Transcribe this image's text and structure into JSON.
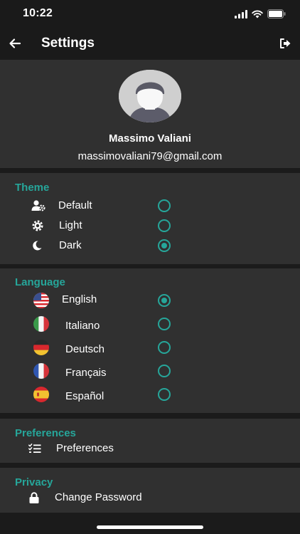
{
  "status_bar": {
    "time": "10:22"
  },
  "app_bar": {
    "title": "Settings"
  },
  "profile": {
    "name": "Massimo Valiani",
    "email": "massimovaliani79@gmail.com"
  },
  "theme": {
    "header": "Theme",
    "options": [
      {
        "label": "Default",
        "icon": "user-gear-icon",
        "selected": false
      },
      {
        "label": "Light",
        "icon": "sun-icon",
        "selected": false
      },
      {
        "label": "Dark",
        "icon": "moon-icon",
        "selected": true
      }
    ]
  },
  "language": {
    "header": "Language",
    "options": [
      {
        "label": "English",
        "icon": "us-flag-icon",
        "selected": true
      },
      {
        "label": "Italiano",
        "icon": "italy-flag-icon",
        "selected": false
      },
      {
        "label": "Deutsch",
        "icon": "germany-flag-icon",
        "selected": false
      },
      {
        "label": "Français",
        "icon": "france-flag-icon",
        "selected": false
      },
      {
        "label": "Español",
        "icon": "spain-flag-icon",
        "selected": false
      }
    ]
  },
  "preferences": {
    "header": "Preferences",
    "item_label": "Preferences",
    "icon": "checklist-icon"
  },
  "privacy": {
    "header": "Privacy",
    "item_label": "Change Password",
    "icon": "lock-icon"
  },
  "colors": {
    "accent": "#26a69a",
    "background": "#1b1b1b",
    "section": "#303030"
  }
}
